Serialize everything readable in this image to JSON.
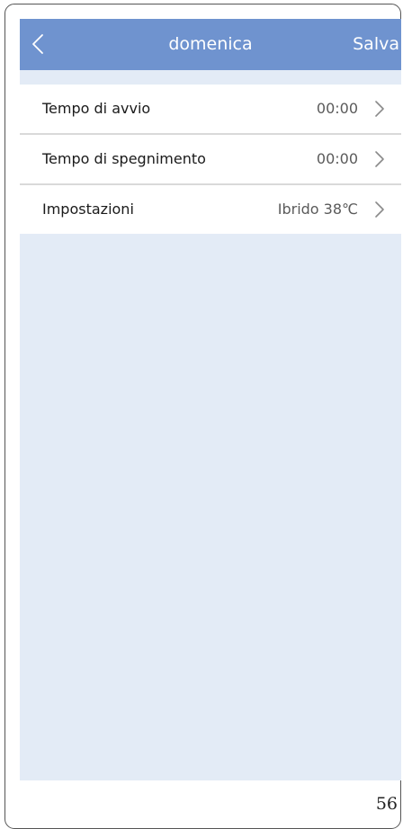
{
  "header": {
    "back_icon": "chevron-left-icon",
    "title": "domenica",
    "save_label": "Salva",
    "background_color": "#6f93cf"
  },
  "settings": [
    {
      "label": "Tempo di avvio",
      "value": "00:00",
      "icon": "chevron-right-icon"
    },
    {
      "label": "Tempo di spegnimento",
      "value": "00:00",
      "icon": "chevron-right-icon"
    },
    {
      "label": "Impostazioni",
      "value": "Ibrido 38℃",
      "icon": "chevron-right-icon"
    }
  ],
  "screen_background_color": "#e3ebf6",
  "page_number": "56"
}
